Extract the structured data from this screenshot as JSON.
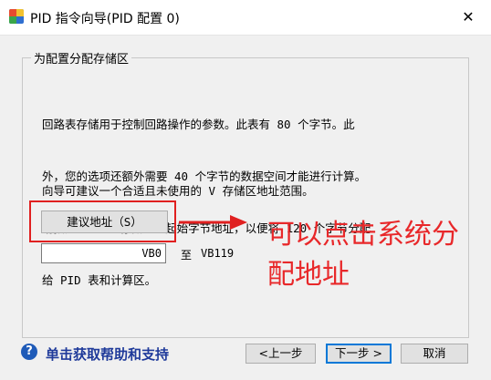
{
  "window": {
    "title": "PID 指令向导(PID 配置 0)",
    "close_symbol": "✕"
  },
  "group": {
    "legend": "为配置分配存储区",
    "description_lines": [
      "回路表存储用于控制回路操作的参数。此表有 80 个字节。此",
      "外，您的选项还额外需要 40 个字节的数据空间才能进行计算。",
      "请指定一个 V 存储区的起始字节地址，以便将 120 个字节分配",
      "给 PID 表和计算区。"
    ],
    "hint": "向导可建议一个合适且未使用的 V 存储区地址范围。",
    "suggest_button": "建议地址（S）",
    "start_address": "VB0",
    "to_label": "至",
    "end_address": "VB119"
  },
  "annotation": {
    "lines": [
      "可以点击系统分",
      "配地址"
    ],
    "color": "#e8282a"
  },
  "footer": {
    "help_icon_glyph": "?",
    "help_link": "单击获取帮助和支持",
    "prev_button": "<上一步",
    "next_button": "下一步 >",
    "cancel_button": "取消"
  }
}
